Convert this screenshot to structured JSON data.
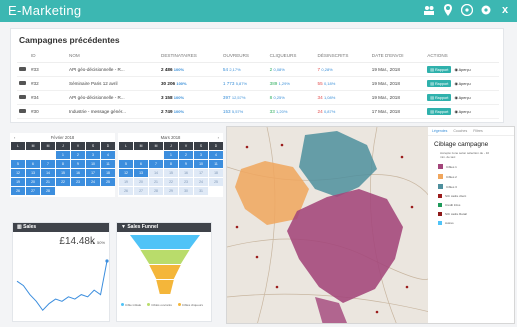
{
  "app": {
    "title": "E-Marketing"
  },
  "topbar": {
    "icons": [
      "users-icon",
      "location-pin-icon",
      "help-icon",
      "settings-icon",
      "close-icon"
    ],
    "close_label": "x"
  },
  "campaigns": {
    "title": "Campagnes précédentes",
    "columns": [
      "ID",
      "NOM",
      "DESTINATAIRES",
      "OUVREURS",
      "CLIQUEURS",
      "DÉSINSCRITS",
      "DATE D'ENVOI",
      "ACTIONS"
    ],
    "rows": [
      {
        "id": "#33",
        "name": "API géo-décisionnelle - R...",
        "recipients": "2 486",
        "recipients_pct": "100%",
        "openers": "54",
        "openers_pct": "2,17%",
        "clickers": "2",
        "clickers_pct": "0,08%",
        "unsub": "7",
        "unsub_pct": "0,28%",
        "date": "19 Mar., 2018"
      },
      {
        "id": "#32",
        "name": "Séminaire Paris 12 avril",
        "recipients": "30 206",
        "recipients_pct": "100%",
        "openers": "1 773",
        "openers_pct": "5,87%",
        "clickers": "389",
        "clickers_pct": "1,29%",
        "unsub": "55",
        "unsub_pct": "0,18%",
        "date": "19 Mar., 2018"
      },
      {
        "id": "#34",
        "name": "API géo-décisionnelle - R...",
        "recipients": "3 158",
        "recipients_pct": "100%",
        "openers": "397",
        "openers_pct": "12,57%",
        "clickers": "8",
        "clickers_pct": "0,25%",
        "unsub": "34",
        "unsub_pct": "1,08%",
        "date": "19 Mar., 2018"
      },
      {
        "id": "#30",
        "name": "Industrie - message génér...",
        "recipients": "2 749",
        "recipients_pct": "100%",
        "openers": "153",
        "openers_pct": "5,57%",
        "clickers": "33",
        "clickers_pct": "1,20%",
        "unsub": "24",
        "unsub_pct": "0,87%",
        "date": "17 Mar., 2018"
      }
    ],
    "report_label": "Rapport",
    "preview_label": "Aperçu"
  },
  "calendars": [
    {
      "month": "Février 2018",
      "days": [
        "L",
        "M",
        "M",
        "J",
        "V",
        "S",
        "D"
      ],
      "cells": [
        "",
        "",
        "",
        "1",
        "2",
        "3",
        "4",
        "5",
        "6",
        "7",
        "8",
        "9",
        "10",
        "11",
        "12",
        "13",
        "14",
        "15",
        "16",
        "17",
        "18",
        "19",
        "20",
        "21",
        "22",
        "23",
        "24",
        "25",
        "26",
        "27",
        "28",
        "",
        "",
        "",
        ""
      ]
    },
    {
      "month": "Mars 2018",
      "days": [
        "L",
        "M",
        "M",
        "J",
        "V",
        "S",
        "D"
      ],
      "cells": [
        "",
        "",
        "",
        "1",
        "2",
        "3",
        "4",
        "5",
        "6",
        "7",
        "8",
        "9",
        "10",
        "11",
        "12",
        "13",
        "14",
        "15",
        "16",
        "17",
        "18",
        "19",
        "20",
        "21",
        "22",
        "23",
        "24",
        "25",
        "26",
        "27",
        "28",
        "29",
        "30",
        "31",
        ""
      ]
    }
  ],
  "sales": {
    "title": "Sales",
    "value": "£14.48k",
    "trend": "▲ 50%",
    "chart_data": {
      "type": "line",
      "values": [
        16,
        14,
        10,
        7,
        3,
        6,
        8,
        7,
        9,
        8,
        10,
        9,
        12,
        10,
        25
      ]
    }
  },
  "funnel": {
    "title": "Sales Funnel",
    "chart_data": {
      "type": "funnel",
      "values": [
        100,
        70,
        45,
        25
      ]
    },
    "colors": [
      "#4fc3f7",
      "#b9dc6b",
      "#f4b63a",
      "#f4b63a"
    ],
    "legend": [
      "Cible initiale",
      "Ciblés ouvrants",
      "Ciblés cliqueurs"
    ]
  },
  "map": {
    "legend_tabs": [
      "Légendes",
      "Couches",
      "Filtres"
    ],
    "legend_title": "Ciblage campagne",
    "legend_subtitle": "Accepté zone selon sélection de - 10 min. de taxi",
    "legend_items": [
      {
        "label": "Cibles 1",
        "color": "#a3457a"
      },
      {
        "label": "Cibles 2",
        "color": "#f0a65d"
      },
      {
        "label": "Cibles 3",
        "color": "#4e8f9d"
      },
      {
        "label": "SIC cadre client",
        "color": "#9b1c1c"
      },
      {
        "label": "Crédit Infos",
        "color": "#1f9a5a"
      },
      {
        "label": "SIC cadre Retail",
        "color": "#8e1a1a"
      },
      {
        "label": "Autres",
        "color": "#4fc3f7"
      }
    ]
  }
}
